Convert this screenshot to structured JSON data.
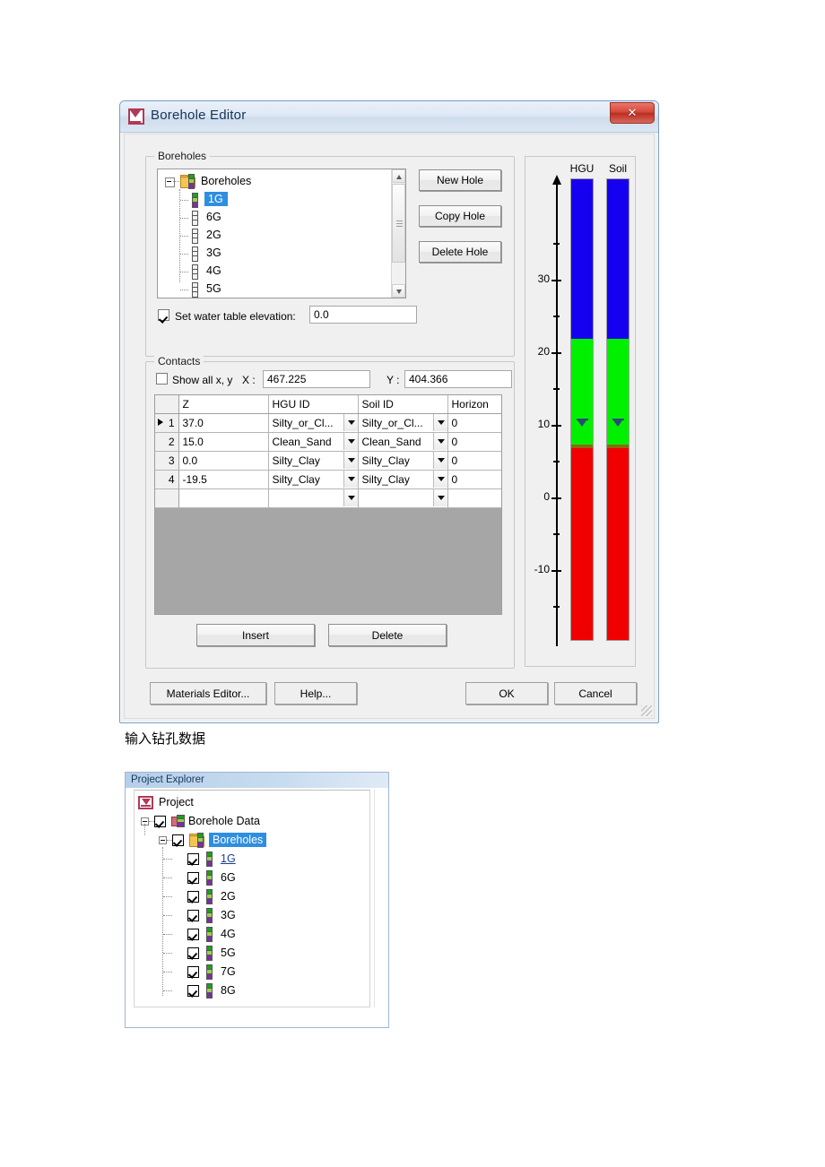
{
  "dialog": {
    "title": "Borehole Editor",
    "app_icon": "gms-project-icon",
    "close_label": "✕",
    "boreholes_group": {
      "label": "Boreholes",
      "tree_root": "Boreholes",
      "items": [
        {
          "label": "1G",
          "selected": true
        },
        {
          "label": "6G",
          "selected": false
        },
        {
          "label": "2G",
          "selected": false
        },
        {
          "label": "3G",
          "selected": false
        },
        {
          "label": "4G",
          "selected": false
        },
        {
          "label": "5G",
          "selected": false
        }
      ],
      "buttons": [
        {
          "label": "New Hole"
        },
        {
          "label": "Copy Hole"
        },
        {
          "label": "Delete Hole"
        }
      ],
      "water_table": {
        "label": "Set water table elevation:",
        "checked": true,
        "value": "0.0"
      }
    },
    "contacts_group": {
      "label": "Contacts",
      "show_all_label": "Show all x, y",
      "show_all_checked": false,
      "x_label": "X :",
      "x_value": "467.225",
      "y_label": "Y :",
      "y_value": "404.366",
      "columns": [
        "",
        "Z",
        "HGU ID",
        "Soil ID",
        "Horizon"
      ],
      "rows": [
        {
          "num": "1",
          "current": true,
          "z": "37.0",
          "hgu": "Silty_or_Cl...",
          "soil": "Silty_or_Cl...",
          "horizon": "0"
        },
        {
          "num": "2",
          "current": false,
          "z": "15.0",
          "hgu": "Clean_Sand",
          "soil": "Clean_Sand",
          "horizon": "0"
        },
        {
          "num": "3",
          "current": false,
          "z": "0.0",
          "hgu": "Silty_Clay",
          "soil": "Silty_Clay",
          "horizon": "0"
        },
        {
          "num": "4",
          "current": false,
          "z": "-19.5",
          "hgu": "Silty_Clay",
          "soil": "Silty_Clay",
          "horizon": "0"
        },
        {
          "num": "",
          "current": false,
          "z": "",
          "hgu": "",
          "soil": "",
          "horizon": ""
        }
      ],
      "insert_label": "Insert",
      "delete_label": "Delete"
    },
    "footer": {
      "materials_editor_label": "Materials Editor...",
      "help_label": "Help...",
      "ok_label": "OK",
      "cancel_label": "Cancel"
    }
  },
  "chart_data": {
    "type": "bar",
    "title": "",
    "xlabel": "",
    "ylabel": "",
    "ylim": [
      -22,
      38
    ],
    "grid": false,
    "legend": "none",
    "axis_ticks_major": [
      30,
      20,
      10,
      0,
      -10
    ],
    "axis_tick_labels": [
      "30",
      "20",
      "10",
      "0",
      "-10"
    ],
    "axis_ticks_minor": [
      35,
      25,
      15,
      5,
      -5,
      -15,
      -20
    ],
    "water_table_elevation": 0.0,
    "series": [
      {
        "name": "HGU",
        "segments": [
          {
            "top": 37.0,
            "bottom": 15.0,
            "material": "Silty_or_Cl...",
            "color": "#1500f0"
          },
          {
            "top": 15.0,
            "bottom": 0.0,
            "material": "Clean_Sand",
            "color": "#00f000"
          },
          {
            "top": 0.0,
            "bottom": -19.5,
            "material": "Silty_Clay",
            "color": "#f00000"
          }
        ]
      },
      {
        "name": "Soil",
        "segments": [
          {
            "top": 37.0,
            "bottom": 15.0,
            "material": "Silty_or_Cl...",
            "color": "#1500f0"
          },
          {
            "top": 15.0,
            "bottom": 0.0,
            "material": "Clean_Sand",
            "color": "#00f000"
          },
          {
            "top": 0.0,
            "bottom": -19.5,
            "material": "Silty_Clay",
            "color": "#f00000"
          }
        ]
      }
    ]
  },
  "caption": "输入钻孔数据",
  "explorer": {
    "panel_title": "Project Explorer",
    "root": "Project",
    "borehole_data": "Borehole Data",
    "boreholes": "Boreholes",
    "items": [
      {
        "label": "1G",
        "checked": true,
        "link": true
      },
      {
        "label": "6G",
        "checked": true,
        "link": false
      },
      {
        "label": "2G",
        "checked": true,
        "link": false
      },
      {
        "label": "3G",
        "checked": true,
        "link": false
      },
      {
        "label": "4G",
        "checked": true,
        "link": false
      },
      {
        "label": "5G",
        "checked": true,
        "link": false
      },
      {
        "label": "7G",
        "checked": true,
        "link": false
      },
      {
        "label": "8G",
        "checked": true,
        "link": false
      }
    ]
  }
}
